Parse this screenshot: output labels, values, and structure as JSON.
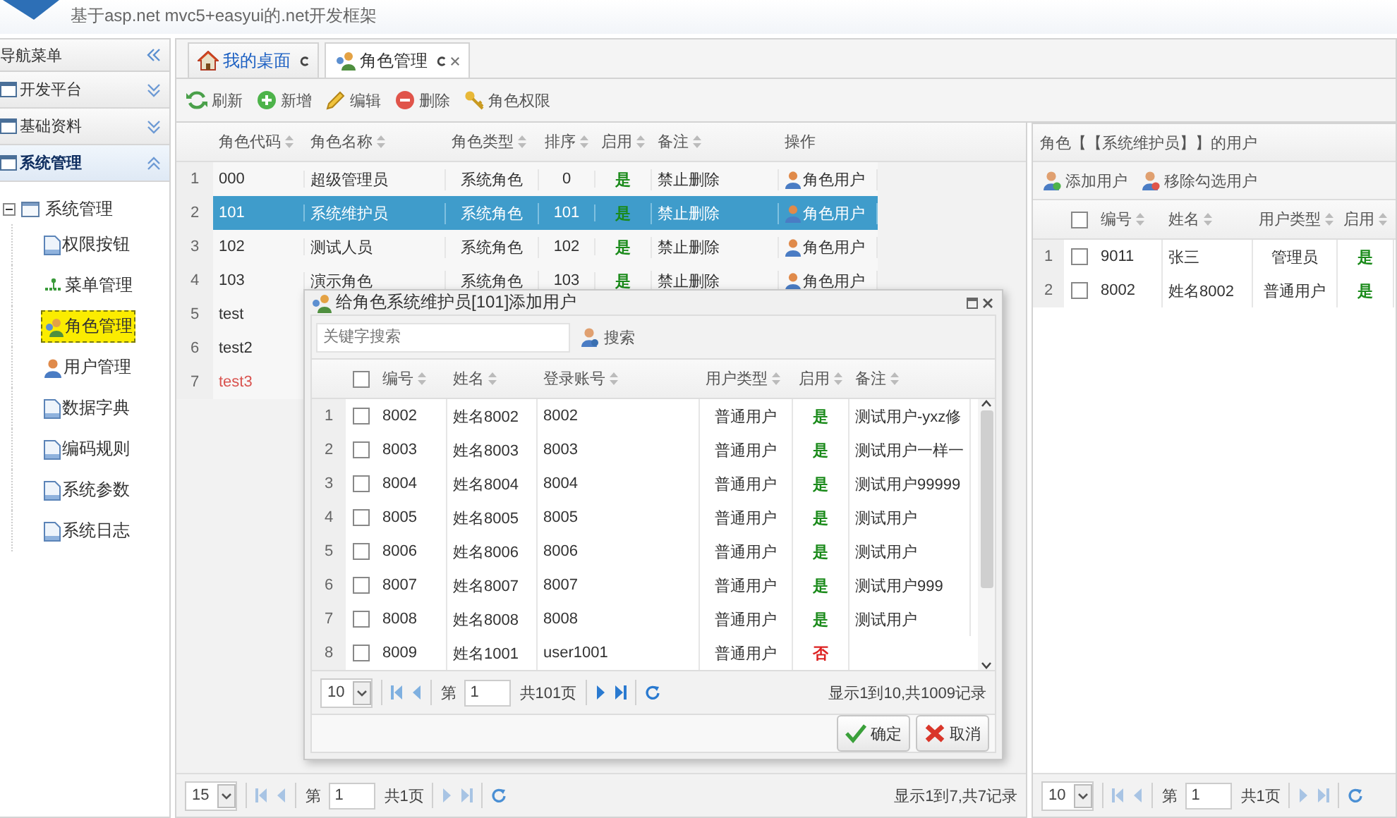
{
  "header": {
    "title": "基于asp.net mvc5+easyui的.net开发框架"
  },
  "sidebar": {
    "title": "导航菜单",
    "sections": [
      {
        "label": "开发平台",
        "expanded": false
      },
      {
        "label": "基础资料",
        "expanded": false
      },
      {
        "label": "系统管理",
        "expanded": true
      }
    ],
    "tree": {
      "label": "系统管理",
      "expanded": true,
      "children": [
        {
          "label": "权限按钮",
          "kind": "page",
          "selected": false
        },
        {
          "label": "菜单管理",
          "kind": "menu",
          "selected": false
        },
        {
          "label": "角色管理",
          "kind": "role",
          "selected": true
        },
        {
          "label": "用户管理",
          "kind": "user",
          "selected": false
        },
        {
          "label": "数据字典",
          "kind": "page",
          "selected": false
        },
        {
          "label": "编码规则",
          "kind": "page",
          "selected": false
        },
        {
          "label": "系统参数",
          "kind": "page",
          "selected": false
        },
        {
          "label": "系统日志",
          "kind": "page",
          "selected": false
        }
      ]
    }
  },
  "tabs": [
    {
      "label": "我的桌面",
      "kind": "home",
      "selected": false,
      "closable": false
    },
    {
      "label": "角色管理",
      "kind": "role",
      "selected": true,
      "closable": true
    }
  ],
  "toolbar": [
    {
      "label": "刷新",
      "kind": "refresh"
    },
    {
      "label": "新增",
      "kind": "add"
    },
    {
      "label": "编辑",
      "kind": "edit"
    },
    {
      "label": "删除",
      "kind": "delete"
    },
    {
      "label": "角色权限",
      "kind": "key"
    }
  ],
  "roles": {
    "columns": [
      "角色代码",
      "角色名称",
      "角色类型",
      "排序",
      "启用",
      "备注",
      "操作"
    ],
    "rows": [
      {
        "index": "1",
        "code": "000",
        "name": "超级管理员",
        "type": "系统角色",
        "order": "0",
        "enabled": "是",
        "enabled_on": true,
        "note": "禁止删除",
        "action": "角色用户",
        "selected": false,
        "disabled": false
      },
      {
        "index": "2",
        "code": "101",
        "name": "系统维护员",
        "type": "系统角色",
        "order": "101",
        "enabled": "是",
        "enabled_on": true,
        "note": "禁止删除",
        "action": "角色用户",
        "selected": true,
        "disabled": false
      },
      {
        "index": "3",
        "code": "102",
        "name": "测试人员",
        "type": "系统角色",
        "order": "102",
        "enabled": "是",
        "enabled_on": true,
        "note": "禁止删除",
        "action": "角色用户",
        "selected": false,
        "disabled": false
      },
      {
        "index": "4",
        "code": "103",
        "name": "演示角色",
        "type": "系统角色",
        "order": "103",
        "enabled": "是",
        "enabled_on": true,
        "note": "禁止删除",
        "action": "角色用户",
        "selected": false,
        "disabled": false
      },
      {
        "index": "5",
        "code": "test",
        "selected": false,
        "disabled": false
      },
      {
        "index": "6",
        "code": "test2",
        "selected": false,
        "disabled": false
      },
      {
        "index": "7",
        "code": "test3",
        "selected": false,
        "disabled": true
      }
    ],
    "pager": {
      "page_size": "15",
      "page_label": "第",
      "page": "1",
      "total_pages": "共1页",
      "summary": "显示1到7,共7记录"
    }
  },
  "role_users": {
    "title": "角色【【系统维护员】】的用户",
    "toolbar": [
      {
        "label": "添加用户",
        "kind": "add"
      },
      {
        "label": "移除勾选用户",
        "kind": "remove"
      }
    ],
    "select_all_checked": false,
    "columns": [
      "编号",
      "姓名",
      "用户类型",
      "启用"
    ],
    "rows": [
      {
        "index": "1",
        "id": "9011",
        "name": "张三",
        "type": "管理员",
        "enabled": "是",
        "enabled_on": true,
        "checked": false
      },
      {
        "index": "2",
        "id": "8002",
        "name": "姓名8002",
        "type": "普通用户",
        "enabled": "是",
        "enabled_on": true,
        "checked": false
      }
    ],
    "pager": {
      "page_size": "10",
      "page_label": "第",
      "page": "1",
      "total_pages": "共1页"
    }
  },
  "dialog": {
    "title": "给角色系统维护员[101]添加用户",
    "search": {
      "placeholder": "关键字搜索",
      "button": "搜索"
    },
    "select_all_checked": false,
    "columns": [
      "编号",
      "姓名",
      "登录账号",
      "用户类型",
      "启用",
      "备注"
    ],
    "rows": [
      {
        "index": "1",
        "id": "8002",
        "name": "姓名8002",
        "login": "8002",
        "type": "普通用户",
        "enabled": "是",
        "enabled_on": true,
        "note": "测试用户-yxz修",
        "checked": false
      },
      {
        "index": "2",
        "id": "8003",
        "name": "姓名8003",
        "login": "8003",
        "type": "普通用户",
        "enabled": "是",
        "enabled_on": true,
        "note": "测试用户一样一",
        "checked": false
      },
      {
        "index": "3",
        "id": "8004",
        "name": "姓名8004",
        "login": "8004",
        "type": "普通用户",
        "enabled": "是",
        "enabled_on": true,
        "note": "测试用户99999",
        "checked": false
      },
      {
        "index": "4",
        "id": "8005",
        "name": "姓名8005",
        "login": "8005",
        "type": "普通用户",
        "enabled": "是",
        "enabled_on": true,
        "note": "测试用户",
        "checked": false
      },
      {
        "index": "5",
        "id": "8006",
        "name": "姓名8006",
        "login": "8006",
        "type": "普通用户",
        "enabled": "是",
        "enabled_on": true,
        "note": "测试用户",
        "checked": false
      },
      {
        "index": "6",
        "id": "8007",
        "name": "姓名8007",
        "login": "8007",
        "type": "普通用户",
        "enabled": "是",
        "enabled_on": true,
        "note": "测试用户999",
        "checked": false
      },
      {
        "index": "7",
        "id": "8008",
        "name": "姓名8008",
        "login": "8008",
        "type": "普通用户",
        "enabled": "是",
        "enabled_on": true,
        "note": "测试用户",
        "checked": false
      },
      {
        "index": "8",
        "id": "8009",
        "name": "姓名1001",
        "login": "user1001",
        "type": "普通用户",
        "enabled": "否",
        "enabled_on": false,
        "checked": false
      }
    ],
    "pager": {
      "page_size": "10",
      "page_label": "第",
      "page": "1",
      "total_pages": "共101页",
      "summary": "显示1到10,共1009记录"
    },
    "buttons": [
      {
        "label": "确定",
        "kind": "ok"
      },
      {
        "label": "取消",
        "kind": "cancel"
      }
    ]
  }
}
